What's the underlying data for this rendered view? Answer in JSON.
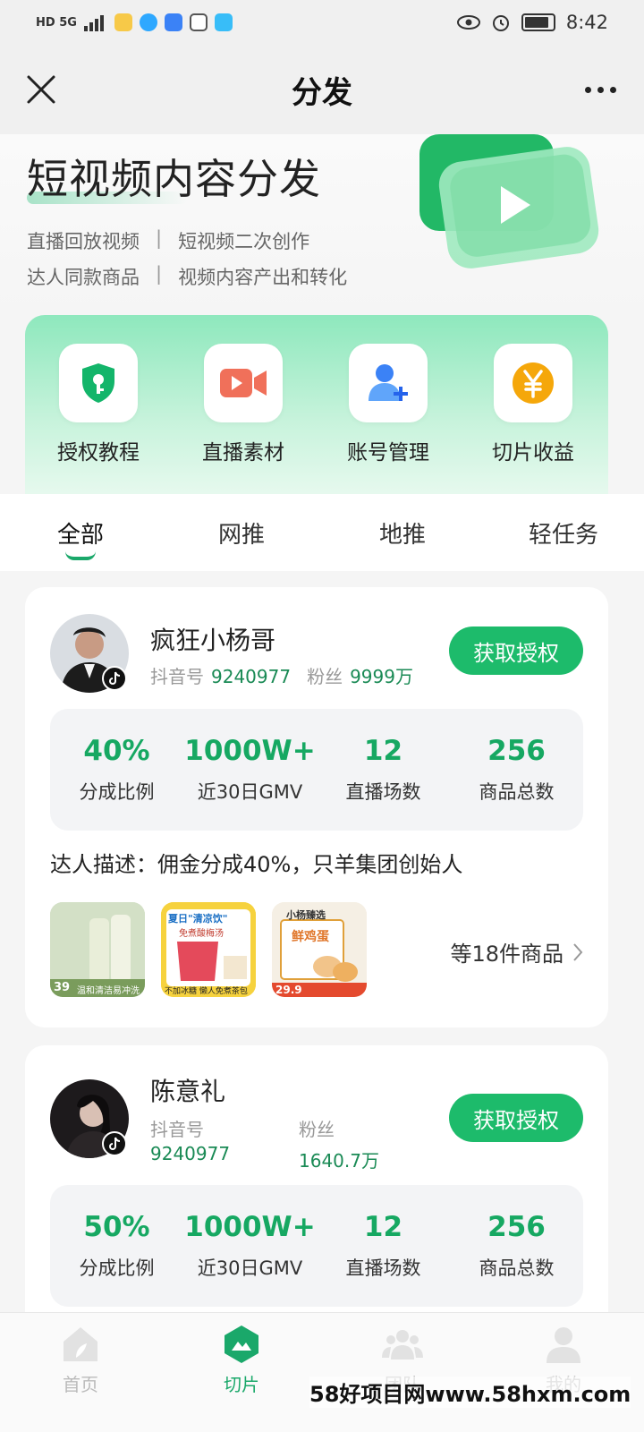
{
  "status_bar": {
    "left_text": "HD 5G",
    "time": "8:42",
    "icons": [
      "signal-icon",
      "app-icon",
      "app-icon",
      "cloud-icon",
      "hand-icon",
      "app-icon",
      "eye-icon",
      "alarm-icon",
      "battery-icon"
    ]
  },
  "topbar": {
    "title": "分发"
  },
  "hero": {
    "title": "短视频内容分发",
    "line1": [
      "直播回放视频",
      "短视频二次创作"
    ],
    "line2": [
      "达人同款商品",
      "视频内容产出和转化"
    ],
    "separator": "|"
  },
  "quick_actions": [
    {
      "label": "授权教程",
      "icon": "key-shield-icon",
      "color": "#13b56a"
    },
    {
      "label": "直播素材",
      "icon": "video-camera-icon",
      "color": "#f0705a"
    },
    {
      "label": "账号管理",
      "icon": "add-user-icon",
      "color": "#3b82f6"
    },
    {
      "label": "切片收益",
      "icon": "yuan-coin-icon",
      "color": "#f5a70a"
    }
  ],
  "tabs": [
    {
      "label": "全部",
      "active": true
    },
    {
      "label": "网推",
      "active": false
    },
    {
      "label": "地推",
      "active": false
    },
    {
      "label": "轻任务",
      "active": false
    }
  ],
  "cards": [
    {
      "name": "疯狂小杨哥",
      "douyin_label": "抖音号",
      "douyin_id": "9240977",
      "fans_label": "粉丝",
      "fans": "9999万",
      "button": "获取授权",
      "stats": [
        {
          "value": "40%",
          "label": "分成比例"
        },
        {
          "value": "1000W+",
          "label": "近30日GMV"
        },
        {
          "value": "12",
          "label": "直播场数"
        },
        {
          "value": "256",
          "label": "商品总数"
        }
      ],
      "description": "达人描述：佣金分成40%，只羊集团创始人",
      "products": [
        {
          "price": "39",
          "caption": "温和清洁易冲洗"
        },
        {
          "top_text": "夏日\"清凉饮\"",
          "sub_text": "免煮酸梅汤",
          "caption": "不加冰糖 懒人免煮茶包"
        },
        {
          "price": "29.9",
          "brand": "小杨臻选",
          "product_name": "鲜鸡蛋"
        }
      ],
      "more_products": "等18件商品"
    },
    {
      "name": "陈意礼",
      "douyin_label": "抖音号",
      "douyin_id": "9240977",
      "fans_label": "粉丝",
      "fans": "1640.7万",
      "button": "获取授权",
      "stats": [
        {
          "value": "50%",
          "label": "分成比例"
        },
        {
          "value": "1000W+",
          "label": "近30日GMV"
        },
        {
          "value": "12",
          "label": "直播场数"
        },
        {
          "value": "256",
          "label": "商品总数"
        }
      ]
    }
  ],
  "bottom_nav": [
    {
      "label": "首页",
      "icon": "home-icon",
      "active": false
    },
    {
      "label": "切片",
      "icon": "slice-icon",
      "active": true
    },
    {
      "label": "团队",
      "icon": "team-icon",
      "active": false
    },
    {
      "label": "我的",
      "icon": "profile-icon",
      "active": false
    }
  ],
  "watermark": "58好项目网www.58hxm.com"
}
